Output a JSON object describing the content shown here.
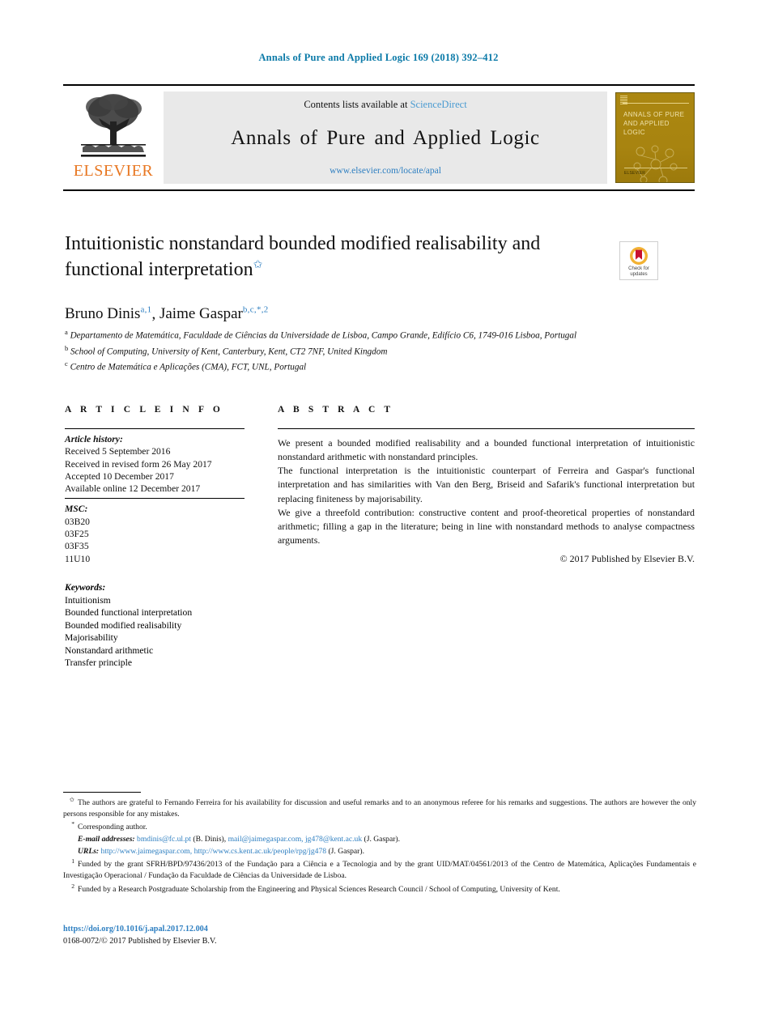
{
  "running_head": "Annals of Pure and Applied Logic 169 (2018) 392–412",
  "masthead": {
    "publisher_name": "ELSEVIER",
    "contents_prefix": "Contents lists available at ",
    "contents_link": "ScienceDirect",
    "journal_title": "Annals of Pure and Applied Logic",
    "journal_url": "www.elsevier.com/locate/apal",
    "cover_title": "ANNALS OF PURE AND APPLIED LOGIC",
    "cover_footer": "ELSEVIER"
  },
  "crossmark": {
    "line1": "Check for",
    "line2": "updates"
  },
  "article": {
    "title": "Intuitionistic nonstandard bounded modified realisability and functional interpretation",
    "title_footnote_marker": "✩",
    "authors": [
      {
        "name": "Bruno Dinis",
        "marks": "a,1"
      },
      {
        "name": "Jaime Gaspar",
        "marks": "b,c,*,2"
      }
    ],
    "authors_separator": ", ",
    "affiliations": [
      {
        "mark": "a",
        "text": "Departamento de Matemática, Faculdade de Ciências da Universidade de Lisboa, Campo Grande, Edifício C6, 1749-016 Lisboa, Portugal"
      },
      {
        "mark": "b",
        "text": "School of Computing, University of Kent, Canterbury, Kent, CT2 7NF, United Kingdom"
      },
      {
        "mark": "c",
        "text": "Centro de Matemática e Aplicações (CMA), FCT, UNL, Portugal"
      }
    ]
  },
  "info": {
    "heading": "A R T I C L E   I N F O",
    "history_label": "Article history:",
    "history": [
      "Received 5 September 2016",
      "Received in revised form 26 May 2017",
      "Accepted 10 December 2017",
      "Available online 12 December 2017"
    ],
    "msc_label": "MSC:",
    "msc": [
      "03B20",
      "03F25",
      "03F35",
      "11U10"
    ],
    "keywords_label": "Keywords:",
    "keywords": [
      "Intuitionism",
      "Bounded functional interpretation",
      "Bounded modified realisability",
      "Majorisability",
      "Nonstandard arithmetic",
      "Transfer principle"
    ]
  },
  "abstract": {
    "heading": "A B S T R A C T",
    "paragraphs": [
      "We present a bounded modified realisability and a bounded functional interpretation of intuitionistic nonstandard arithmetic with nonstandard principles.",
      "The functional interpretation is the intuitionistic counterpart of Ferreira and Gaspar's functional interpretation and has similarities with Van den Berg, Briseid and Safarik's functional interpretation but replacing finiteness by majorisability.",
      "We give a threefold contribution: constructive content and proof-theoretical properties of nonstandard arithmetic; filling a gap in the literature; being in line with nonstandard methods to analyse compactness arguments."
    ],
    "copyright": "© 2017 Published by Elsevier B.V."
  },
  "footnotes": {
    "star_note": "The authors are grateful to Fernando Ferreira for his availability for discussion and useful remarks and to an anonymous referee for his remarks and suggestions. The authors are however the only persons responsible for any mistakes.",
    "corresponding": "Corresponding author.",
    "email_label": "E-mail addresses:",
    "emails": [
      {
        "address": "bmdinis@fc.ul.pt",
        "owner": "(B. Dinis),"
      },
      {
        "address": "mail@jaimegaspar.com,",
        "owner": ""
      },
      {
        "address": "jg478@kent.ac.uk",
        "owner": "(J. Gaspar)."
      }
    ],
    "urls_label": "URLs:",
    "urls": [
      {
        "address": "http://www.jaimegaspar.com,",
        "owner": ""
      },
      {
        "address": "http://www.cs.kent.ac.uk/people/rpg/jg478",
        "owner": "(J. Gaspar)."
      }
    ],
    "note1_marker": "1",
    "note1": "Funded by the grant SFRH/BPD/97436/2013 of the Fundação para a Ciência e a Tecnologia and by the grant UID/MAT/04561/2013 of the Centro de Matemática, Aplicações Fundamentais e Investigação Operacional / Fundação da Faculdade de Ciências da Universidade de Lisboa.",
    "note2_marker": "2",
    "note2": "Funded by a Research Postgraduate Scholarship from the Engineering and Physical Sciences Research Council / School of Computing, University of Kent."
  },
  "bottom": {
    "doi": "https://doi.org/10.1016/j.apal.2017.12.004",
    "issn_line": "0168-0072/© 2017 Published by Elsevier B.V."
  },
  "colors": {
    "link": "#2e7fc1",
    "running_head": "#0b7aa8",
    "elsevier_orange": "#E87722",
    "cover_gold": "#a8840f"
  }
}
